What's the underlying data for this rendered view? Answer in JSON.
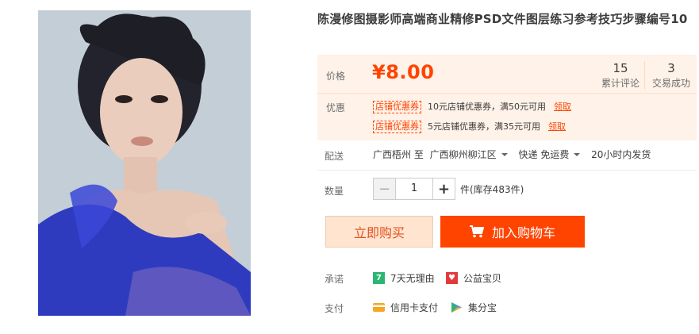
{
  "product": {
    "title": "陈漫修图摄影师高端商业精修PSD文件图层练习参考技巧步骤编号10"
  },
  "price": {
    "label": "价格",
    "value": "¥8.00",
    "reviews_count": "15",
    "reviews_label": "累计评论",
    "trades_count": "3",
    "trades_label": "交易成功"
  },
  "coupon": {
    "label": "优惠",
    "items": [
      {
        "tag": "店铺优惠券",
        "text": "10元店铺优惠券，满50元可用",
        "claim": "领取"
      },
      {
        "tag": "店铺优惠券",
        "text": "5元店铺优惠券，满35元可用",
        "claim": "领取"
      }
    ]
  },
  "delivery": {
    "label": "配送",
    "from": "广西梧州 至",
    "to": "广西柳州柳江区",
    "method": "快递 免运费",
    "ship_time": "20小时内发货"
  },
  "quantity": {
    "label": "数量",
    "minus": "−",
    "value": "1",
    "plus": "+",
    "stock": "件(库存483件)"
  },
  "actions": {
    "buy_now": "立即购买",
    "add_to_cart": "加入购物车"
  },
  "promise": {
    "label": "承诺",
    "items": [
      {
        "icon": "seven-days-icon",
        "glyph": "7",
        "text": "7天无理由",
        "color": "#2bb673"
      },
      {
        "icon": "charity-heart-icon",
        "glyph": "♥",
        "text": "公益宝贝",
        "color": "#e4393c"
      }
    ]
  },
  "payment": {
    "label": "支付",
    "items": [
      {
        "icon": "credit-card-icon",
        "text": "信用卡支付",
        "color": "#f5a623"
      },
      {
        "icon": "jifenbao-icon",
        "text": "集分宝",
        "color": "#4a90e2"
      }
    ]
  },
  "colors": {
    "accent": "#ff4400",
    "price_bg": "#fff2e8"
  }
}
